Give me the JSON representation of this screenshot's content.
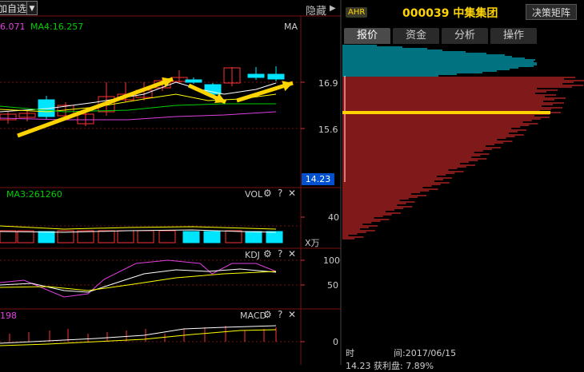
{
  "toolbar": {
    "watchlist_label": "加自选",
    "hide_label": "隐藏",
    "decision_label": "决策矩阵"
  },
  "stock": {
    "badge": "AHR",
    "code_name": "000039 中集集团"
  },
  "price_panel": {
    "ma_text": "6.071",
    "ma4_text": "MA4:16.257",
    "ma_label": "MA",
    "price_ticks": [
      "16.9",
      "15.6"
    ],
    "current_price": "14.23"
  },
  "vol_panel": {
    "ma3_text": "MA3:261260",
    "name": "VOL",
    "tick": "40",
    "unit": "X万"
  },
  "kdj_panel": {
    "name": "KDJ",
    "ticks": [
      "100",
      "50"
    ]
  },
  "macd_panel": {
    "left_text": "198",
    "name": "MACD",
    "tick": "0"
  },
  "tabs": [
    {
      "label": "报价"
    },
    {
      "label": "资金"
    },
    {
      "label": "分析"
    },
    {
      "label": "操作"
    }
  ],
  "info": {
    "time_label": "时",
    "time_value": "间:2017/06/15",
    "partial_text": "14.23 获利盘: 7.89%"
  },
  "colors": {
    "up": "#ff3232",
    "down": "#00e5ff",
    "accent": "#ffd400",
    "ma_white": "#ffffff",
    "ma_yellow": "#ffff00",
    "ma_green": "#00d000",
    "ma_magenta": "#e040e0"
  }
}
